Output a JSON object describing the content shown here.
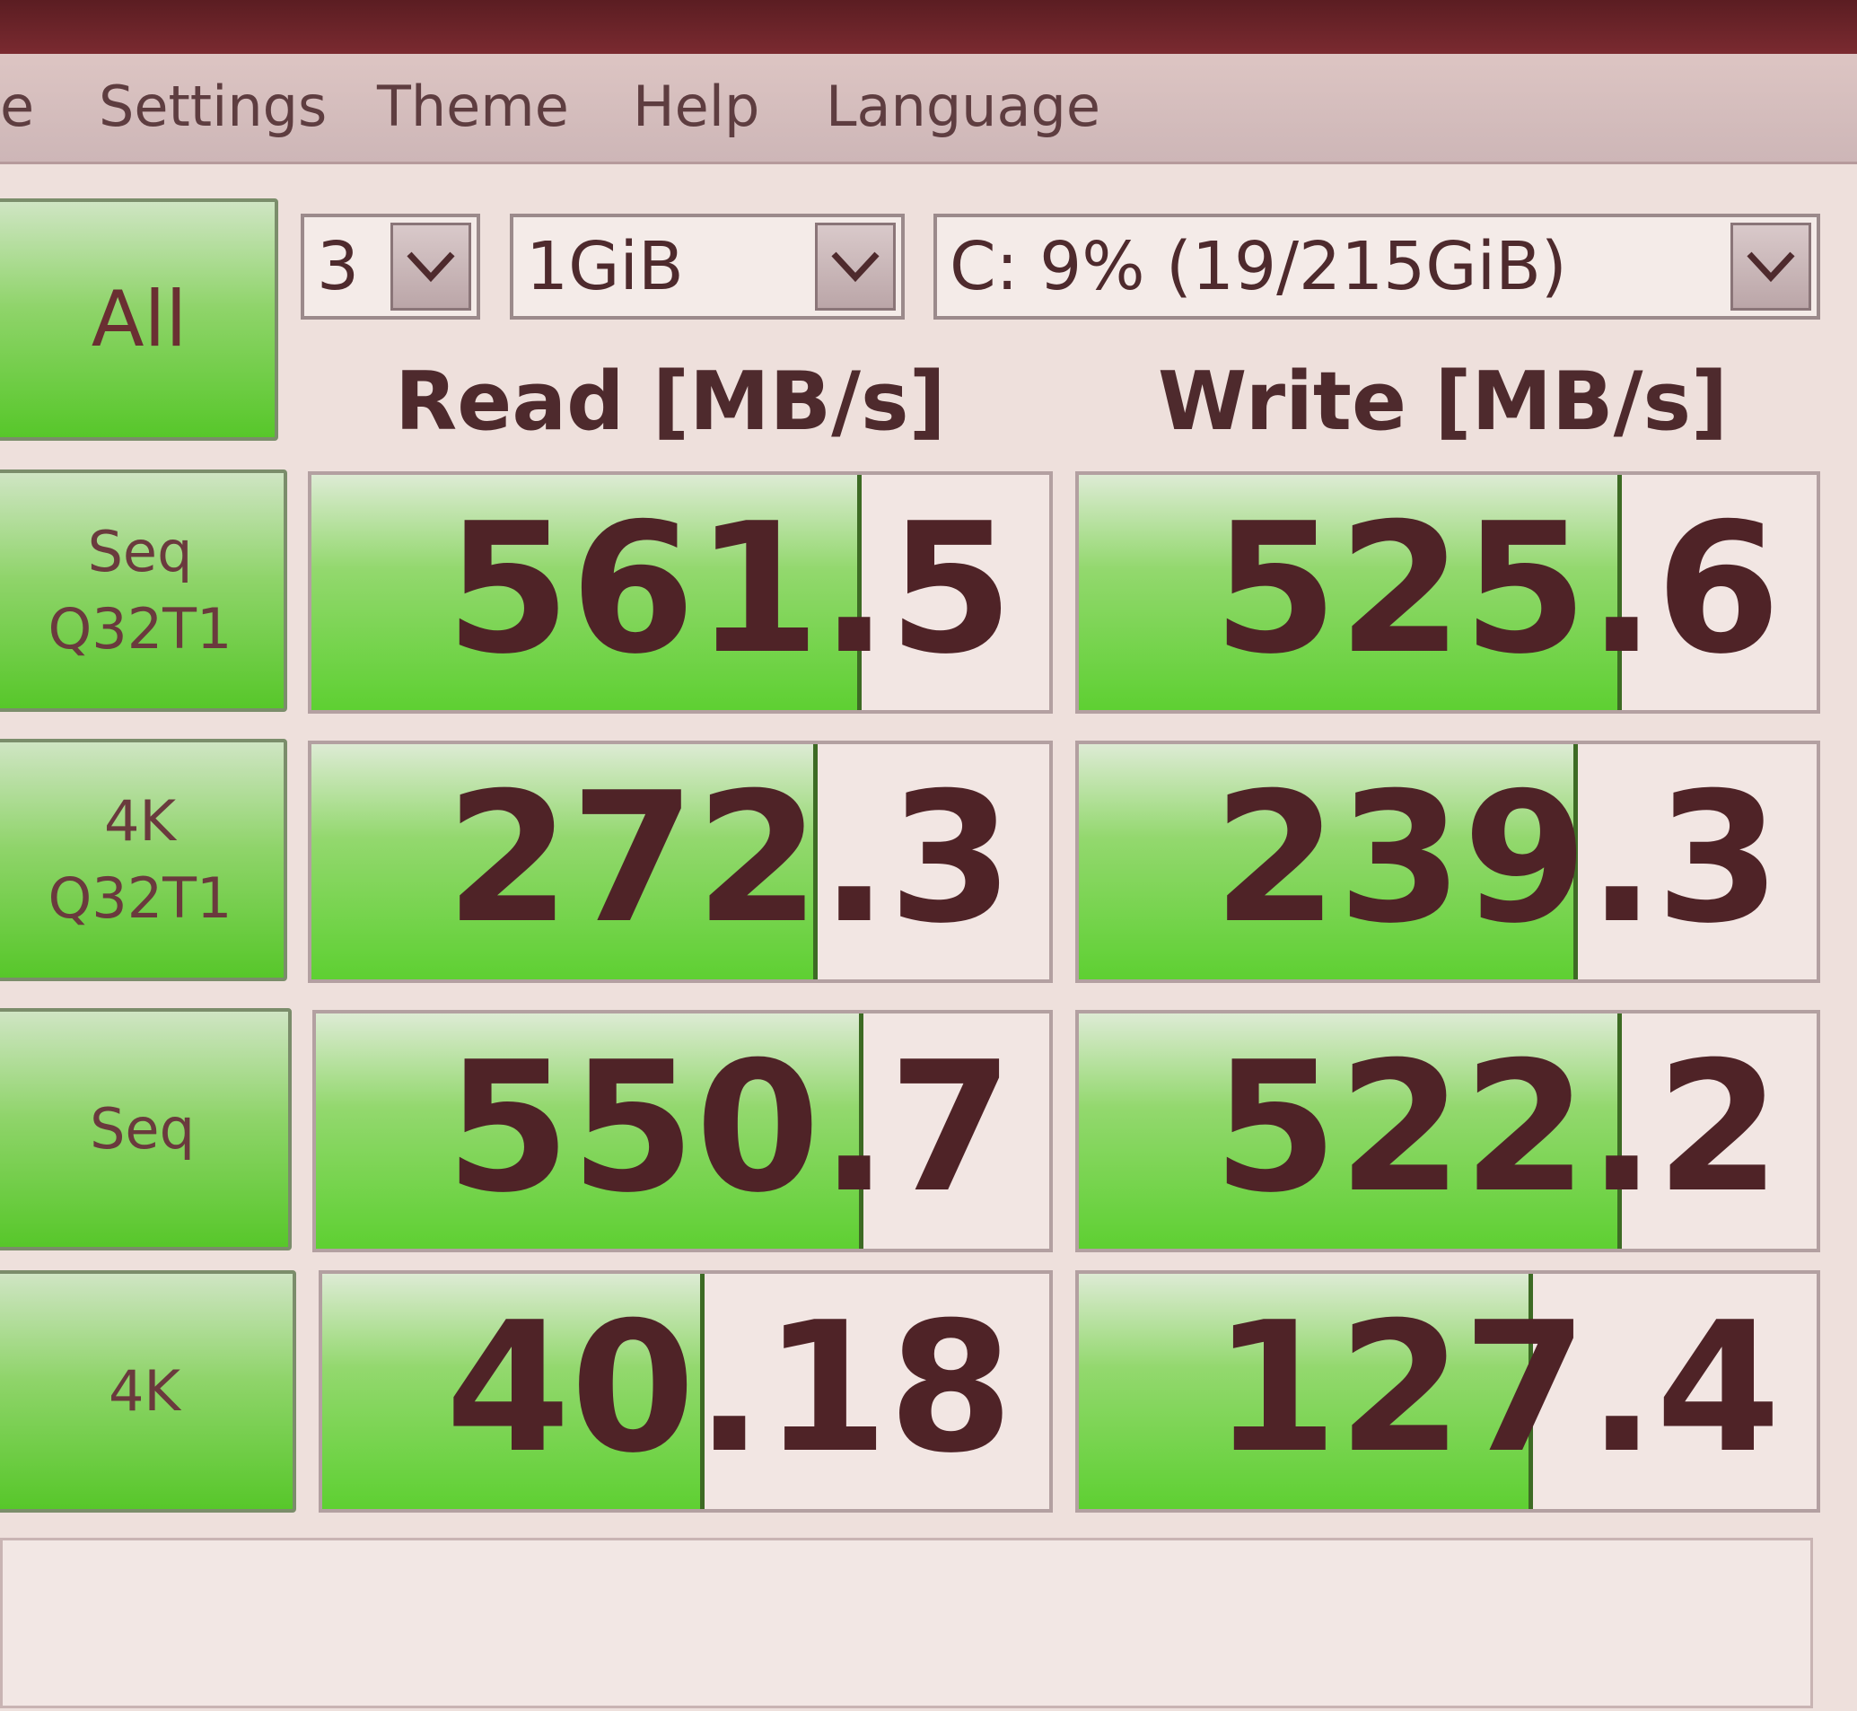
{
  "menu": {
    "items": [
      "e",
      "Settings",
      "Theme",
      "Help",
      "Language"
    ]
  },
  "controls": {
    "all_label": "All",
    "count_value": "3",
    "size_value": "1GiB",
    "drive_value": "C: 9% (19/215GiB)"
  },
  "headers": {
    "read": "Read [MB/s]",
    "write": "Write [MB/s]"
  },
  "rows": [
    {
      "label_line1": "Seq",
      "label_line2": "Q32T1",
      "read": "561.5",
      "write": "525.6",
      "read_fill": 0.74,
      "write_fill": 0.73
    },
    {
      "label_line1": "4K",
      "label_line2": "Q32T1",
      "read": "272.3",
      "write": "239.3",
      "read_fill": 0.68,
      "write_fill": 0.67
    },
    {
      "label_line1": "Seq",
      "label_line2": "",
      "read": "550.7",
      "write": "522.2",
      "read_fill": 0.74,
      "write_fill": 0.73
    },
    {
      "label_line1": "4K",
      "label_line2": "",
      "read": "40.18",
      "write": "127.4",
      "read_fill": 0.52,
      "write_fill": 0.61
    }
  ],
  "colors": {
    "accent_green": "#5ed032",
    "text_dark": "#4f2327"
  },
  "icons": [
    "chevron-down-icon"
  ]
}
